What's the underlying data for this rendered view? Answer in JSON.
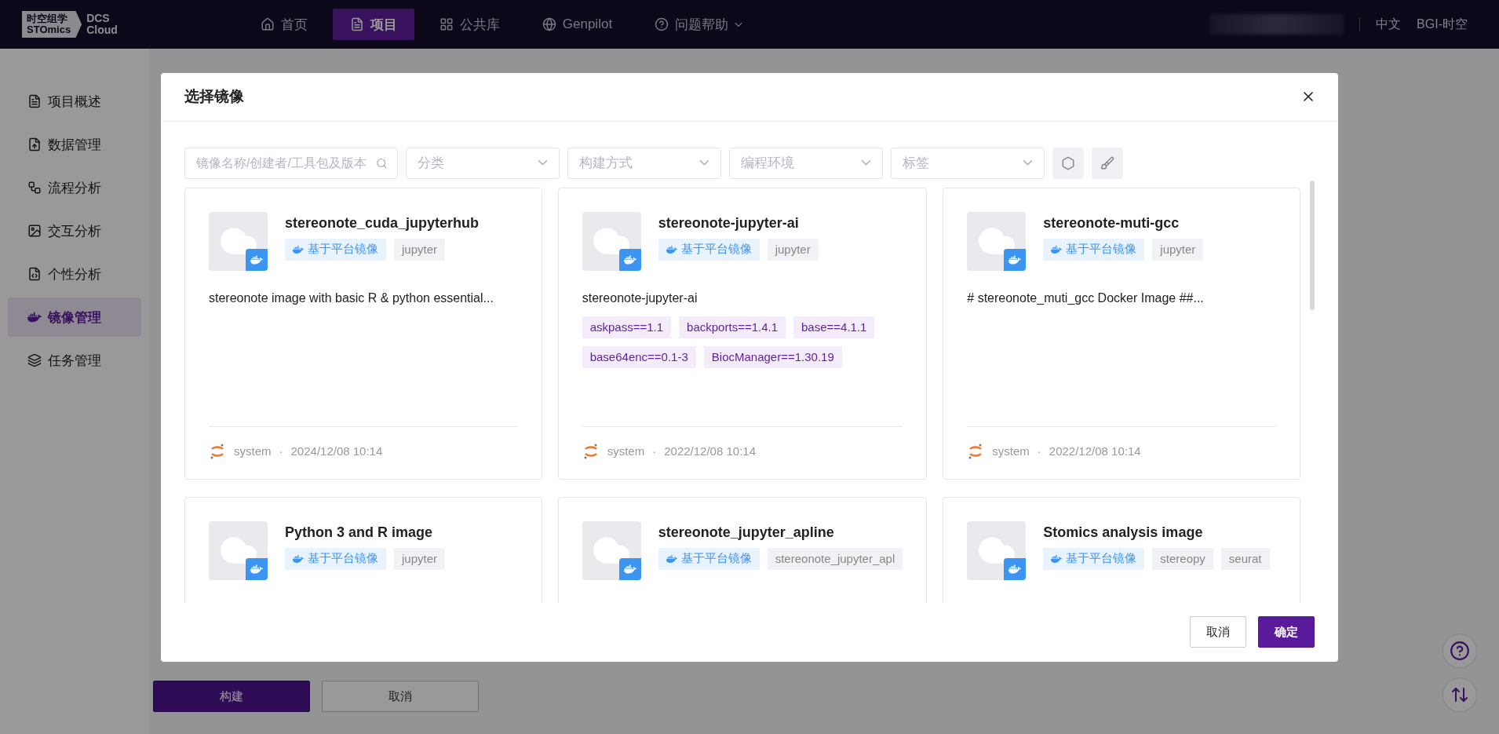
{
  "header": {
    "logo_cn": "时空组学",
    "logo_en": "STOmics",
    "product_line1": "DCS",
    "product_line2": "Cloud",
    "nav": [
      {
        "label": "首页",
        "selected": false
      },
      {
        "label": "项目",
        "selected": true
      },
      {
        "label": "公共库",
        "selected": false
      },
      {
        "label": "Genpilot",
        "selected": false
      },
      {
        "label": "问题帮助",
        "selected": false
      }
    ],
    "language": "中文",
    "org": "BGI-时空"
  },
  "sidebar": [
    {
      "label": "项目概述",
      "selected": false
    },
    {
      "label": "数据管理",
      "selected": false
    },
    {
      "label": "流程分析",
      "selected": false
    },
    {
      "label": "交互分析",
      "selected": false
    },
    {
      "label": "个性分析",
      "selected": false
    },
    {
      "label": "镜像管理",
      "selected": true
    },
    {
      "label": "任务管理",
      "selected": false
    }
  ],
  "page_buttons": [
    {
      "label": "构建",
      "kind": "primary"
    },
    {
      "label": "取消",
      "kind": "default"
    }
  ],
  "dialog": {
    "title": "选择镜像",
    "search": {
      "placeholder": "镜像名称/创建者/工具包及版本"
    },
    "filters": [
      {
        "placeholder": "分类"
      },
      {
        "placeholder": "构建方式"
      },
      {
        "placeholder": "编程环境"
      },
      {
        "placeholder": "标签"
      }
    ],
    "cards": [
      {
        "title": "stereonote_cuda_jupyterhub",
        "tags": [
          {
            "label": "基于平台镜像",
            "kind": "platform"
          },
          {
            "label": "jupyter",
            "kind": "plain"
          }
        ],
        "description": "stereonote image with basic R & python essential...",
        "author": "system",
        "separator": "·",
        "date": "2024/12/08 10:14"
      },
      {
        "title": "stereonote-jupyter-ai",
        "tags": [
          {
            "label": "基于平台镜像",
            "kind": "platform"
          },
          {
            "label": "jupyter",
            "kind": "plain"
          }
        ],
        "description": "stereonote-jupyter-ai",
        "packages": [
          "askpass==1.1",
          "backports==1.4.1",
          "base==4.1.1",
          "base64enc==0.1-3",
          "BiocManager==1.30.19"
        ],
        "author": "system",
        "separator": "·",
        "date": "2022/12/08 10:14"
      },
      {
        "title": "stereonote-muti-gcc",
        "tags": [
          {
            "label": "基于平台镜像",
            "kind": "platform"
          },
          {
            "label": "jupyter",
            "kind": "plain"
          }
        ],
        "description": "# stereonote_muti_gcc Docker Image ##...",
        "author": "system",
        "separator": "·",
        "date": "2022/12/08 10:14"
      },
      {
        "title": "Python 3 and R image",
        "tags": [
          {
            "label": "基于平台镜像",
            "kind": "platform"
          },
          {
            "label": "jupyter",
            "kind": "plain"
          }
        ]
      },
      {
        "title": "stereonote_jupyter_apline",
        "tags": [
          {
            "label": "基于平台镜像",
            "kind": "platform"
          },
          {
            "label": "stereonote_jupyter_apl",
            "kind": "plain"
          }
        ]
      },
      {
        "title": "Stomics analysis image",
        "tags": [
          {
            "label": "基于平台镜像",
            "kind": "platform"
          },
          {
            "label": "stereopy",
            "kind": "plain"
          },
          {
            "label": "seurat",
            "kind": "plain"
          }
        ]
      }
    ],
    "buttons": [
      {
        "label": "取消",
        "kind": "default"
      },
      {
        "label": "确定",
        "kind": "primary"
      }
    ]
  }
}
